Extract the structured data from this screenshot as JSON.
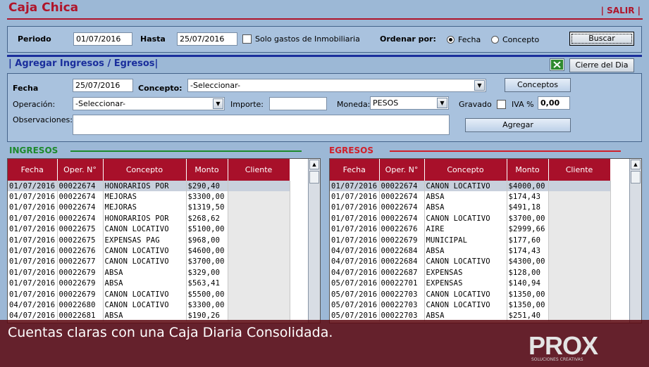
{
  "app": {
    "title": "Caja Chica",
    "logout": "| SALIR |"
  },
  "filter": {
    "periodo_label": "Periodo",
    "periodo_value": "01/07/2016",
    "hasta_label": "Hasta",
    "hasta_value": "25/07/2016",
    "solo_label": "Solo gastos de Inmobiliaria",
    "ordenar_label": "Ordenar por:",
    "fecha_option": "Fecha",
    "concepto_option": "Concepto",
    "buscar_label": "Buscar"
  },
  "add": {
    "section_title": "| Agregar Ingresos / Egresos|",
    "cierre_label": "Cierre del Dia",
    "fecha_label": "Fecha",
    "fecha_value": "25/07/2016",
    "concepto_label": "Concepto:",
    "concepto_value": "-Seleccionar-",
    "conceptos_button": "Conceptos",
    "operacion_label": "Operación:",
    "operacion_value": "-Seleccionar-",
    "importe_label": "Importe:",
    "importe_value": "",
    "moneda_label": "Moneda:",
    "moneda_value": "PESOS",
    "gravado_label": "Gravado",
    "iva_label": "IVA %",
    "iva_value": "0,00",
    "observaciones_label": "Observaciones:",
    "observaciones_value": "",
    "agregar_button": "Agregar"
  },
  "ingresos": {
    "label": "INGRESOS",
    "columns": [
      "Fecha",
      "Oper. N°",
      "Concepto",
      "Monto",
      "Cliente"
    ],
    "rows": [
      [
        "01/07/2016",
        "00022674",
        "HONORARIOS POR",
        "$290,40"
      ],
      [
        "01/07/2016",
        "00022674",
        "MEJORAS",
        "$3300,00"
      ],
      [
        "01/07/2016",
        "00022674",
        "MEJORAS",
        "$1319,50"
      ],
      [
        "01/07/2016",
        "00022674",
        "HONORARIOS POR",
        "$268,62"
      ],
      [
        "01/07/2016",
        "00022675",
        "CANON LOCATIVO",
        "$5100,00"
      ],
      [
        "01/07/2016",
        "00022675",
        "EXPENSAS PAG",
        "$968,00"
      ],
      [
        "01/07/2016",
        "00022676",
        "CANON LOCATIVO",
        "$4600,00"
      ],
      [
        "01/07/2016",
        "00022677",
        "CANON LOCATIVO",
        "$3700,00"
      ],
      [
        "01/07/2016",
        "00022679",
        "ABSA",
        "$329,00"
      ],
      [
        "01/07/2016",
        "00022679",
        "ABSA",
        "$563,41"
      ],
      [
        "01/07/2016",
        "00022679",
        "CANON LOCATIVO",
        "$5500,00"
      ],
      [
        "04/07/2016",
        "00022680",
        "CANON LOCATIVO",
        "$3300,00"
      ],
      [
        "04/07/2016",
        "00022681",
        "ABSA",
        "$190,26"
      ]
    ]
  },
  "egresos": {
    "label": "EGRESOS",
    "columns": [
      "Fecha",
      "Oper. N°",
      "Concepto",
      "Monto",
      "Cliente"
    ],
    "rows": [
      [
        "01/07/2016",
        "00022674",
        "CANON LOCATIVO",
        "$4000,00"
      ],
      [
        "01/07/2016",
        "00022674",
        "ABSA",
        "$174,43"
      ],
      [
        "01/07/2016",
        "00022674",
        "ABSA",
        "$491,18"
      ],
      [
        "01/07/2016",
        "00022674",
        "CANON LOCATIVO",
        "$3700,00"
      ],
      [
        "01/07/2016",
        "00022676",
        "AIRE",
        "$2999,66"
      ],
      [
        "01/07/2016",
        "00022679",
        "MUNICIPAL",
        "$177,60"
      ],
      [
        "04/07/2016",
        "00022684",
        "ABSA",
        "$174,43"
      ],
      [
        "04/07/2016",
        "00022684",
        "CANON LOCATIVO",
        "$4300,00"
      ],
      [
        "04/07/2016",
        "00022687",
        "EXPENSAS",
        "$128,00"
      ],
      [
        "05/07/2016",
        "00022701",
        "EXPENSAS",
        "$140,94"
      ],
      [
        "05/07/2016",
        "00022703",
        "CANON LOCATIVO",
        "$1350,00"
      ],
      [
        "05/07/2016",
        "00022703",
        "CANON LOCATIVO",
        "$1350,00"
      ],
      [
        "05/07/2016",
        "00022703",
        "ABSA",
        "$251,40"
      ]
    ]
  },
  "banner": {
    "text": "Cuentas claras con una Caja Diaria Consolidada.",
    "logo": "PROX",
    "logo_sub": "SOLUCIONES CREATIVAS"
  },
  "colors": {
    "accent": "#b0142a",
    "header": "#a8102a",
    "ingresos_line": "#1d8a2c",
    "egresos_line": "#d0202a",
    "section_blue": "#1a2e9c"
  }
}
